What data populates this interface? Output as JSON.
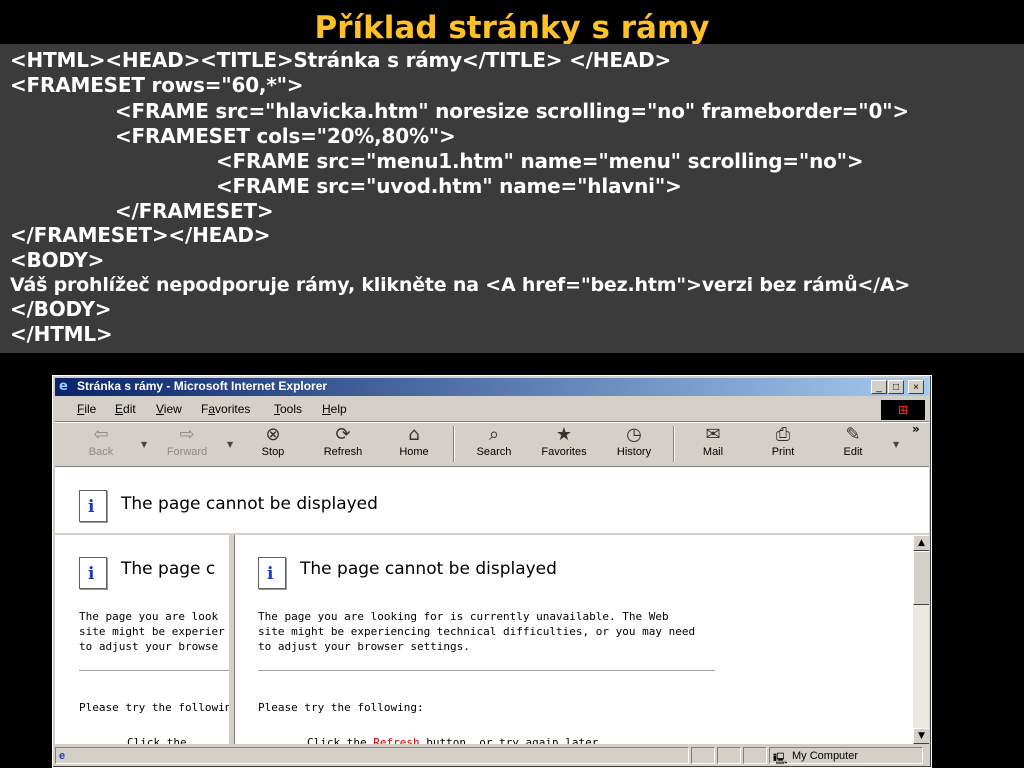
{
  "slide": {
    "title": "Příklad stránky s rámy",
    "code_lines": [
      "<HTML><HEAD><TITLE>Stránka s rámy</TITLE> </HEAD>",
      "<FRAMESET rows=\"60,*\">",
      "<FRAME src=\"hlavicka.htm\" noresize scrolling=\"no\" frameborder=\"0\">",
      "<FRAMESET cols=\"20%,80%\">",
      "<FRAME src=\"menu1.htm\" name=\"menu\" scrolling=\"no\">",
      "<FRAME src=\"uvod.htm\" name=\"hlavni\">",
      "</FRAMESET>",
      "</FRAMESET></HEAD>",
      "<BODY>",
      "Váš prohlížeč nepodporuje rámy,  klikněte na <A href=\"bez.htm\">verzi bez rámů</A>",
      "</BODY>",
      "</HTML>"
    ]
  },
  "browser": {
    "window_title": "Stránka s rámy - Microsoft Internet Explorer",
    "window_buttons": {
      "minimize": "_",
      "maximize": "□",
      "close": "×"
    },
    "menu": [
      {
        "u": "F",
        "rest": "ile"
      },
      {
        "u": "E",
        "rest": "dit"
      },
      {
        "u": "V",
        "rest": "iew"
      },
      {
        "pre": "F",
        "u": "a",
        "rest": "vorites"
      },
      {
        "u": "T",
        "rest": "ools"
      },
      {
        "u": "H",
        "rest": "elp"
      }
    ],
    "toolbar": [
      {
        "label": "Back",
        "icon": "back-arrow-icon",
        "glyph": "⇦"
      },
      {
        "label": "Forward",
        "icon": "forward-arrow-icon",
        "glyph": "⇨"
      },
      {
        "label": "Stop",
        "icon": "stop-icon",
        "glyph": "⊗"
      },
      {
        "label": "Refresh",
        "icon": "refresh-icon",
        "glyph": "⟳"
      },
      {
        "label": "Home",
        "icon": "home-icon",
        "glyph": "⌂"
      },
      {
        "label": "Search",
        "icon": "search-icon",
        "glyph": "⌕"
      },
      {
        "label": "Favorites",
        "icon": "favorites-icon",
        "glyph": "★"
      },
      {
        "label": "History",
        "icon": "history-icon",
        "glyph": "◷"
      },
      {
        "label": "Mail",
        "icon": "mail-icon",
        "glyph": "✉"
      },
      {
        "label": "Print",
        "icon": "print-icon",
        "glyph": "⎙"
      },
      {
        "label": "Edit",
        "icon": "edit-icon",
        "glyph": "✎"
      }
    ],
    "toolbar_more": "»",
    "error_title": "The page cannot be displayed",
    "error_line1": "The page you are looking for is currently unavailable. The Web",
    "error_line2": "site might be experiencing technical difficulties, or you may need",
    "error_line3": "to adjust your browser settings.",
    "left_line1": "The page you are look",
    "left_line2": "site might be experier",
    "left_line3": "to adjust your browse",
    "left_try": "Please try the followin",
    "try_text": "Please try the following:",
    "left_title": "The page c",
    "cutoff_main": "Click the",
    "cutoff_link": "Refresh",
    "cutoff_after": "button, or try again later.",
    "status_zone": "My Computer",
    "colors": {
      "slide_title": "#ffc125",
      "code_bg": "#3b3b3b",
      "chrome": "#d4d0c8"
    }
  }
}
